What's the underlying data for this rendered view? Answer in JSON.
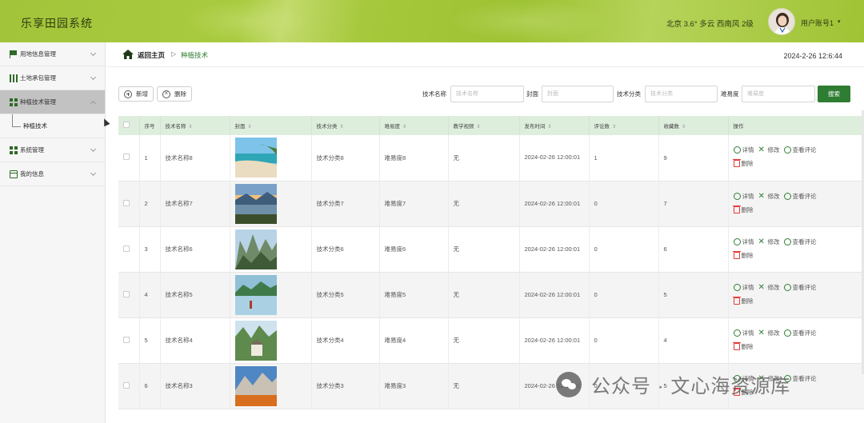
{
  "app": {
    "title": "乐享田园系统"
  },
  "header": {
    "weather": "北京  3.6°  多云  西南风  2级",
    "user": "用户账号1"
  },
  "sidebar": {
    "items": [
      {
        "label": "用地信息管理",
        "icon": "flag-icon"
      },
      {
        "label": "土地承包管理",
        "icon": "bar-chart-icon"
      },
      {
        "label": "种植技术管理",
        "icon": "grid-icon",
        "active": true
      },
      {
        "label": "系统管理",
        "icon": "grid-icon"
      },
      {
        "label": "我的信息",
        "icon": "window-icon"
      }
    ],
    "sub_items": [
      {
        "label": "种植技术"
      }
    ]
  },
  "breadcrumb": {
    "home": "返回主页",
    "sep": "▷",
    "current": "种植技术"
  },
  "datetime": "2024-2-26 12:6:44",
  "toolbar": {
    "add_label": "新增",
    "delete_label": "删除"
  },
  "search": {
    "fields": [
      {
        "label": "技术名称",
        "placeholder": "技术名称"
      },
      {
        "label": "封面",
        "placeholder": "封面"
      },
      {
        "label": "技术分类",
        "placeholder": "技术分类"
      },
      {
        "label": "难易度",
        "placeholder": "难易度"
      }
    ],
    "button": "搜索"
  },
  "table": {
    "headers": [
      "序号",
      "技术名称",
      "封面",
      "技术分类",
      "难易度",
      "教学视频",
      "发布时间",
      "评论数",
      "收藏数",
      "操作"
    ],
    "sort_glyph": "⇕",
    "ops": {
      "detail": "详情",
      "edit": "修改",
      "comments": "查看评论",
      "delete": "删除"
    },
    "rows": [
      {
        "no": "1",
        "name": "技术名称8",
        "category": "技术分类8",
        "difficulty": "难易度8",
        "video": "无",
        "time": "2024-02-26 12:00:01",
        "comments": "1",
        "favorites": "9",
        "cover": "beach"
      },
      {
        "no": "2",
        "name": "技术名称7",
        "category": "技术分类7",
        "difficulty": "难易度7",
        "video": "无",
        "time": "2024-02-26 12:00:01",
        "comments": "0",
        "favorites": "7",
        "cover": "sunset-lake"
      },
      {
        "no": "3",
        "name": "技术名称6",
        "category": "技术分类6",
        "difficulty": "难易度6",
        "video": "无",
        "time": "2024-02-26 12:00:01",
        "comments": "0",
        "favorites": "6",
        "cover": "karst-peaks"
      },
      {
        "no": "4",
        "name": "技术名称5",
        "category": "技术分类5",
        "difficulty": "难易度5",
        "video": "无",
        "time": "2024-02-26 12:00:01",
        "comments": "0",
        "favorites": "5",
        "cover": "misty-lake"
      },
      {
        "no": "5",
        "name": "技术名称4",
        "category": "技术分类4",
        "difficulty": "难易度4",
        "video": "无",
        "time": "2024-02-26 12:00:01",
        "comments": "0",
        "favorites": "4",
        "cover": "mountain-temple"
      },
      {
        "no": "6",
        "name": "技术名称3",
        "category": "技术分类3",
        "difficulty": "难易度3",
        "video": "无",
        "time": "2024-02-26 12:00:01",
        "comments": "0",
        "favorites": "5",
        "cover": "autumn-cliffs"
      }
    ]
  },
  "watermark": {
    "text": "公众号 · 文心海资源库"
  }
}
